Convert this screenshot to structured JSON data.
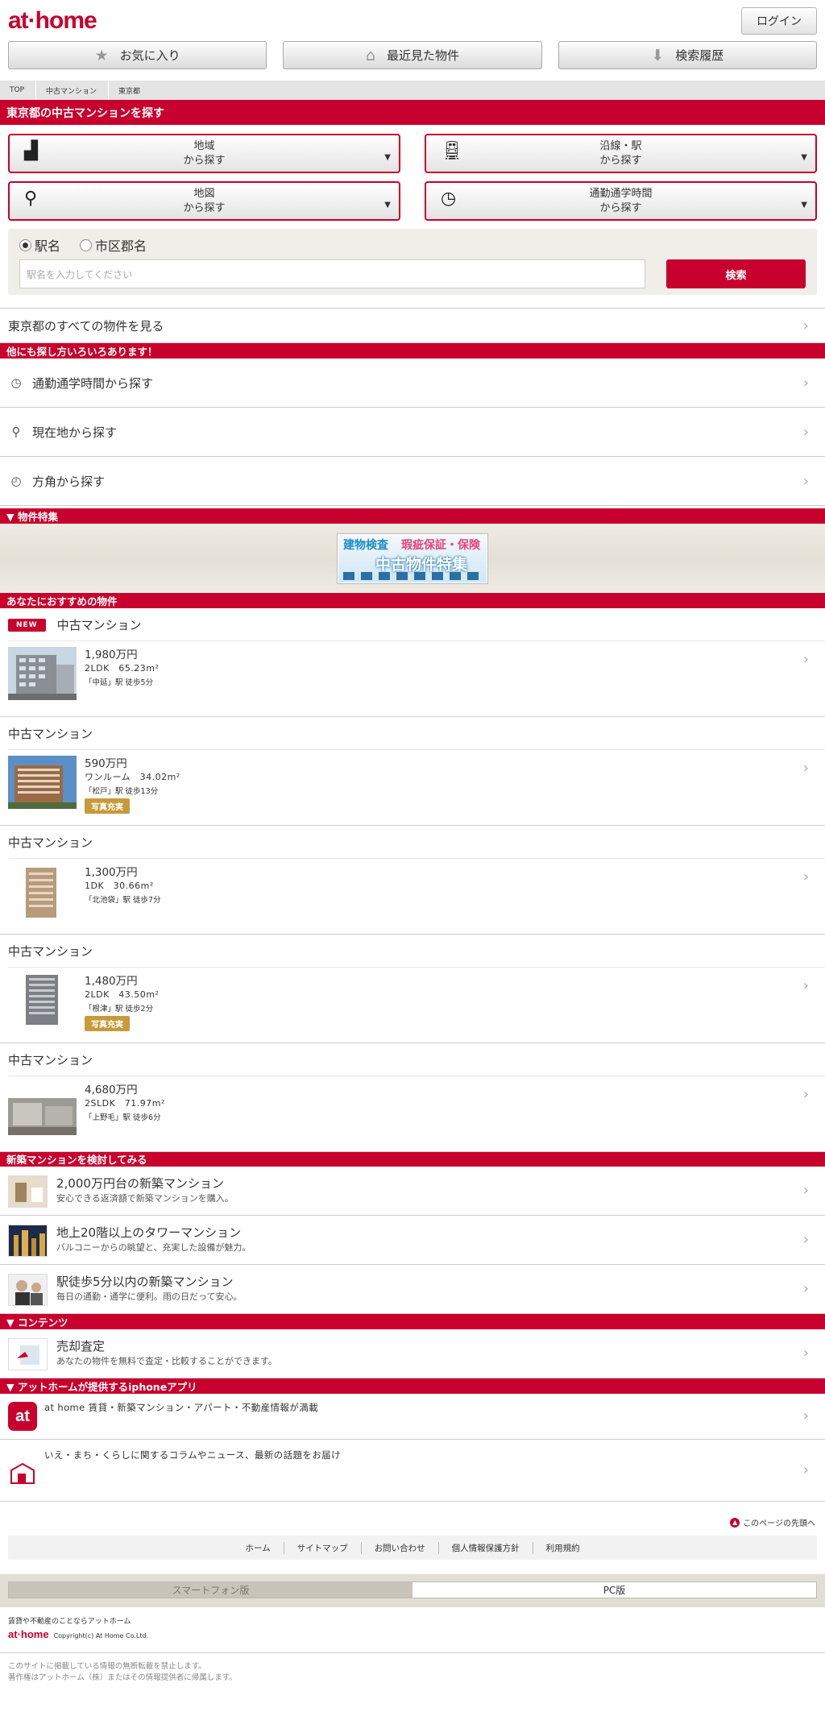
{
  "header": {
    "logo": "at·home",
    "login": "ログイン"
  },
  "nav": [
    {
      "label": "お気に入り",
      "icon": "star-icon"
    },
    {
      "label": "最近見た物件",
      "icon": "house-icon"
    },
    {
      "label": "検索履歴",
      "icon": "inbox-icon"
    }
  ],
  "breadcrumb": [
    "TOP",
    "中古マンション",
    "東京都"
  ],
  "section_title": "東京都の中古マンションを探す",
  "search_buttons": [
    {
      "l1": "地域",
      "l2": "から探す"
    },
    {
      "l1": "沿線・駅",
      "l2": "から探す"
    },
    {
      "l1": "地図",
      "l2": "から探す"
    },
    {
      "l1": "通勤通学時間",
      "l2": "から探す"
    }
  ],
  "search_form": {
    "radio1": "駅名",
    "radio2": "市区郡名",
    "placeholder": "駅名を入力してください",
    "button": "検索"
  },
  "all_link": "東京都のすべての物件を見る",
  "other_bar": "他にも探し方いろいろあります！",
  "alt_links": [
    {
      "label": "通勤通学時間から探す",
      "icon": "clock-icon"
    },
    {
      "label": "現在地から探す",
      "icon": "pin-icon"
    },
    {
      "label": "方角から探す",
      "icon": "compass-icon"
    }
  ],
  "feature_bar": "▼ 物件特集",
  "banner": {
    "t1": "建物検査",
    "t2": "瑕疵保証・保険",
    "t3": "中古物件特集"
  },
  "recommend_bar": "あなたにおすすめの物件",
  "new_badge": "NEW",
  "properties": [
    {
      "type": "中古マンション",
      "price": "1,980万円",
      "layout": "2LDK　65.23m²",
      "station": "「中延」駅 徒歩5分",
      "tag": ""
    },
    {
      "type": "中古マンション",
      "price": "590万円",
      "layout": "ワンルーム　34.02m²",
      "station": "「松戸」駅 徒歩13分",
      "tag": "写真充実"
    },
    {
      "type": "中古マンション",
      "price": "1,300万円",
      "layout": "1DK　30.66m²",
      "station": "「北池袋」駅 徒歩7分",
      "tag": ""
    },
    {
      "type": "中古マンション",
      "price": "1,480万円",
      "layout": "2LDK　43.50m²",
      "station": "「根津」駅 徒歩2分",
      "tag": "写真充実"
    },
    {
      "type": "中古マンション",
      "price": "4,680万円",
      "layout": "2SLDK　71.97m²",
      "station": "「上野毛」駅 徒歩6分",
      "tag": ""
    }
  ],
  "newbuild_bar": "新築マンションを検討してみる",
  "newbuild": [
    {
      "title": "2,000万円台の新築マンション",
      "sub": "安心できる返済額で新築マンションを購入。"
    },
    {
      "title": "地上20階以上のタワーマンション",
      "sub": "バルコニーからの眺望と、充実した設備が魅力。"
    },
    {
      "title": "駅徒歩5分以内の新築マンション",
      "sub": "毎日の通勤・通学に便利。雨の日だって安心。"
    }
  ],
  "contents_bar": "▼ コンテンツ",
  "contents": [
    {
      "title": "売却査定",
      "sub": "あなたの物件を無料で査定・比較することができます。"
    }
  ],
  "apps_bar": "▼ アットホームが提供するiphoneアプリ",
  "apps": [
    {
      "text": "at home 賃貸・新築マンション・アパート・不動産情報が満載",
      "icon_text": "at"
    },
    {
      "text": "いえ・まち・くらしに関するコラムやニュース、最新の話題をお届け",
      "icon_text": ""
    }
  ],
  "to_top": "このページの先頭へ",
  "footer_links": [
    "ホーム",
    "サイトマップ",
    "お問い合わせ",
    "個人情報保護方針",
    "利用規約"
  ],
  "version": {
    "sp": "スマートフォン版",
    "pc": "PC版"
  },
  "footer": {
    "tagline": "賃貸や不動産のことならアットホーム",
    "logo": "at·home",
    "copyright": "Copyright(c) At Home Co.Ltd.",
    "note1": "このサイトに掲載している情報の無断転載を禁止します。",
    "note2": "著作権はアットホーム（株）またはその情報提供者に帰属します。"
  },
  "colors": {
    "brand": "#c8002d",
    "tag": "#c79a3a"
  }
}
